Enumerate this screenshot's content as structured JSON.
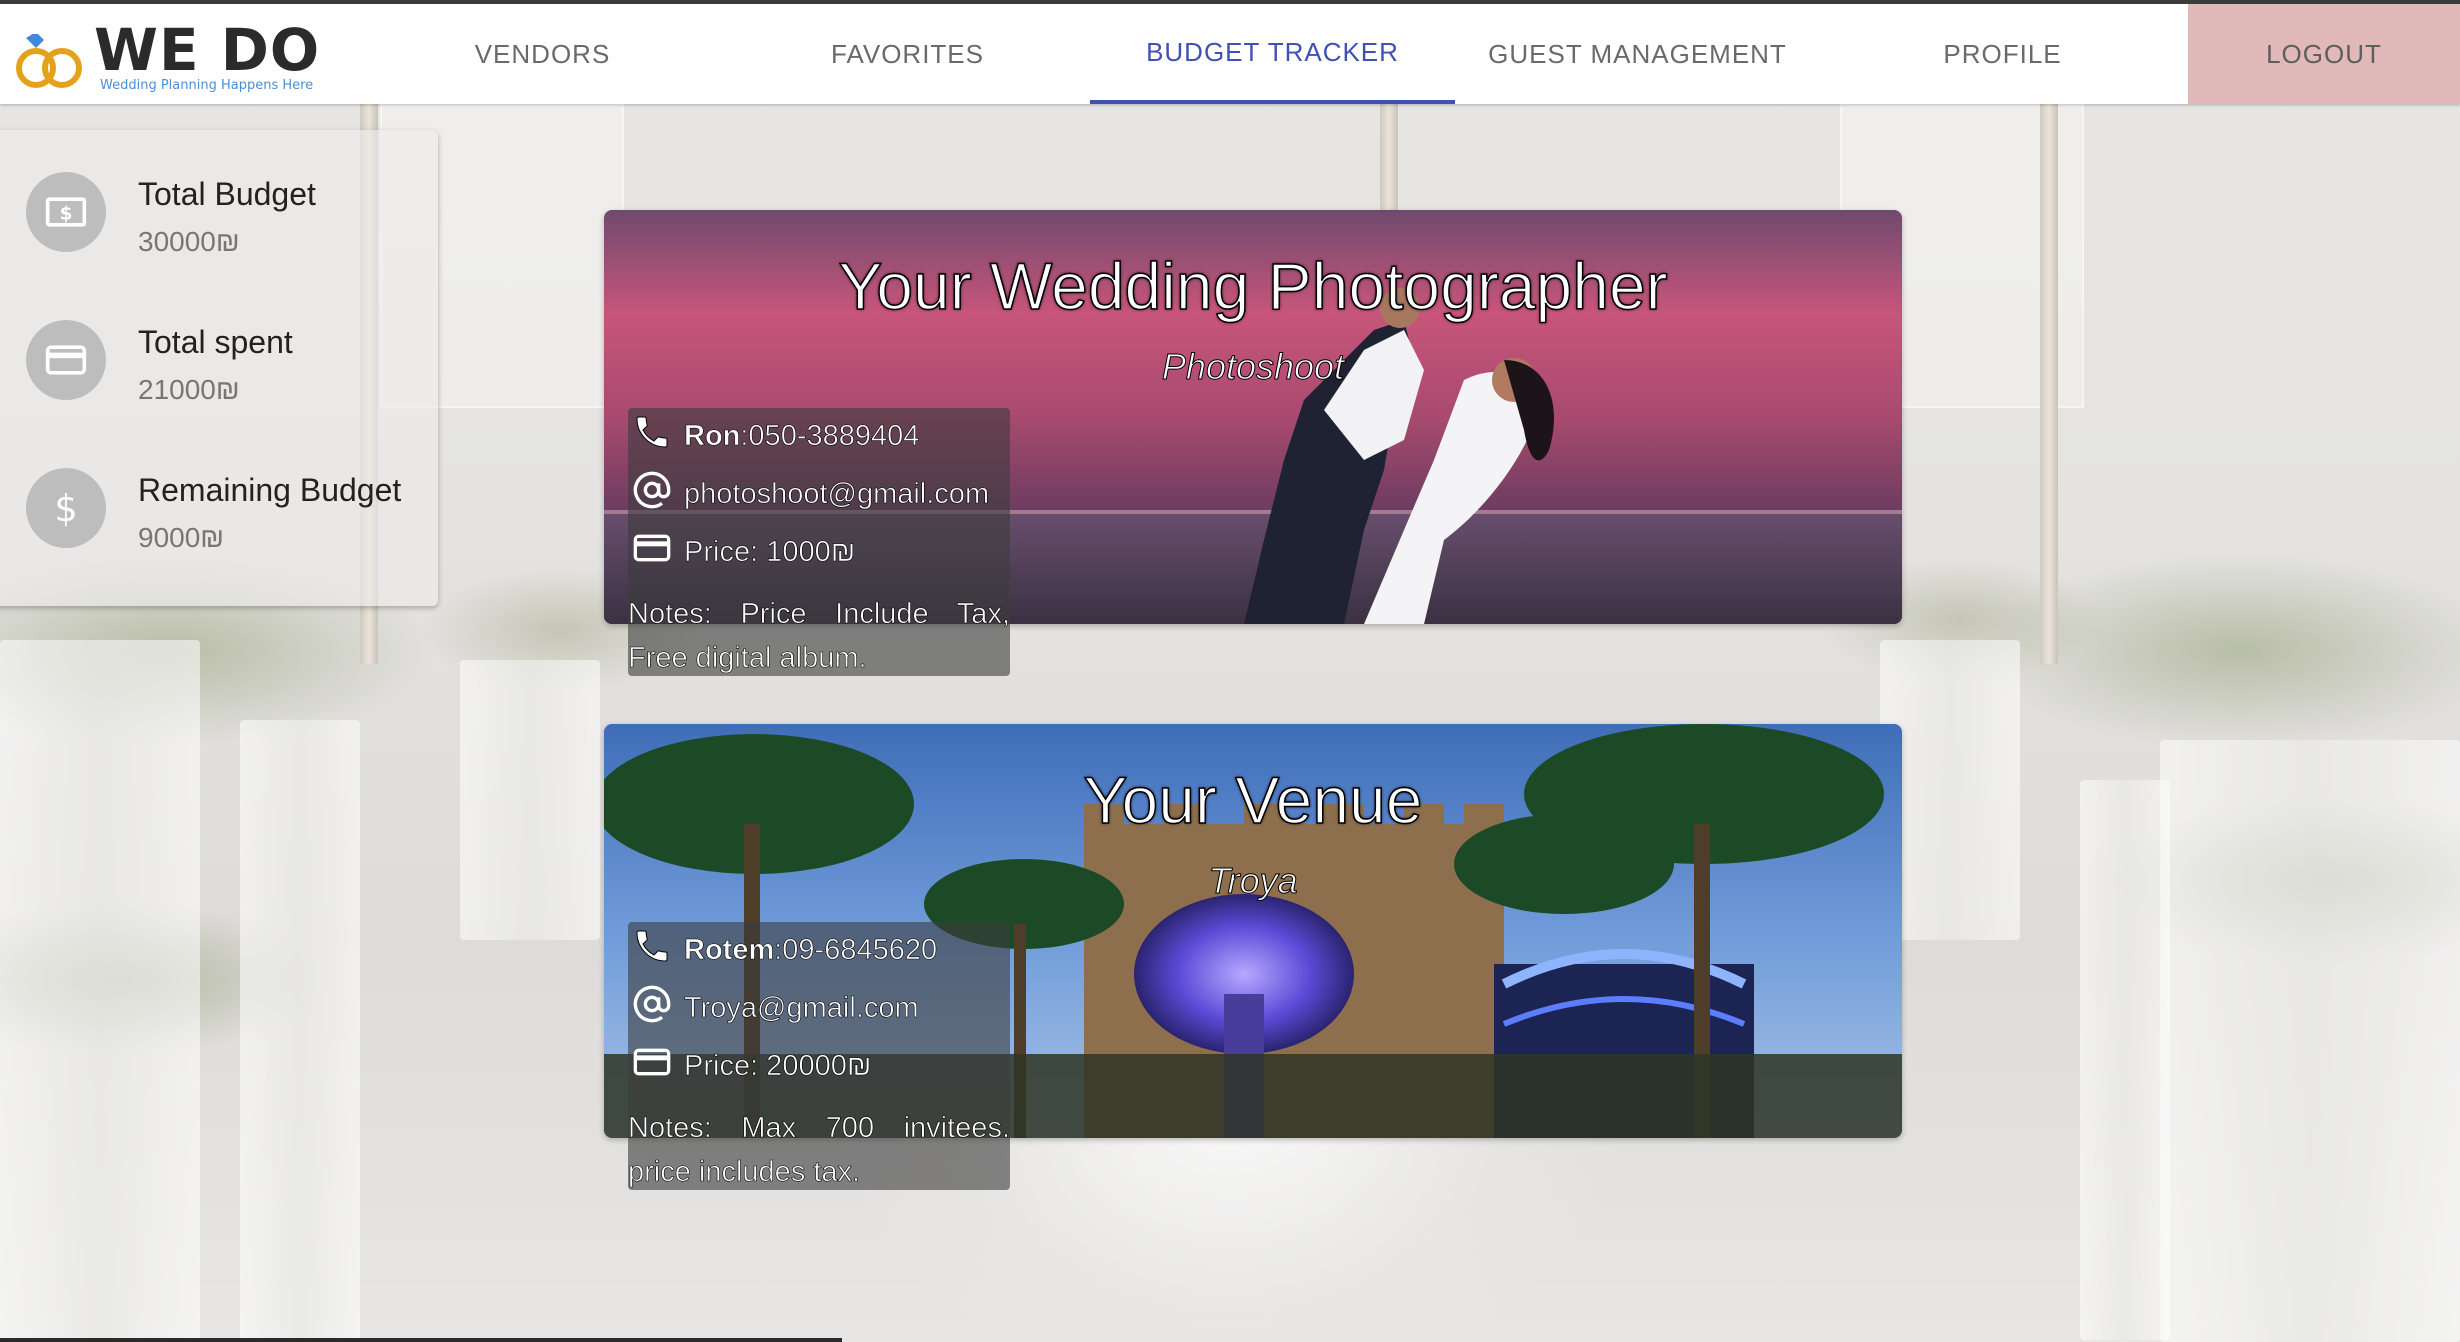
{
  "logo": {
    "text": "WE DO",
    "tagline": "Wedding Planning Happens Here"
  },
  "nav": {
    "tabs": [
      {
        "label": "VENDORS"
      },
      {
        "label": "FAVORITES"
      },
      {
        "label": "BUDGET TRACKER",
        "active": true
      },
      {
        "label": "GUEST MANAGEMENT"
      },
      {
        "label": "PROFILE"
      }
    ],
    "logout_label": "LOGOUT"
  },
  "summary": {
    "items": [
      {
        "label": "Total Budget",
        "value": "30000₪",
        "icon": "money-icon"
      },
      {
        "label": "Total spent",
        "value": "21000₪",
        "icon": "credit-card-icon"
      },
      {
        "label": "Remaining Budget",
        "value": "9000₪",
        "icon": "dollar-icon"
      }
    ]
  },
  "vendors": [
    {
      "title": "Your Wedding Photographer",
      "name": "Photoshoot",
      "contact_name": "Ron",
      "phone": ":050-3889404",
      "email": "photoshoot@gmail.com",
      "price": "Price: 1000₪",
      "notes": "Notes: Price Include Tax, Free digital album."
    },
    {
      "title": "Your Venue",
      "name": "Troya",
      "contact_name": "Rotem",
      "phone": ":09-6845620",
      "email": "Troya@gmail.com",
      "price": "Price: 20000₪",
      "notes": "Notes: Max 700 invitees. price includes tax."
    }
  ],
  "colors": {
    "accent": "#3f51b5",
    "logout_bg": "#e2b9b9",
    "avatar_bg": "#bdbdbd"
  }
}
